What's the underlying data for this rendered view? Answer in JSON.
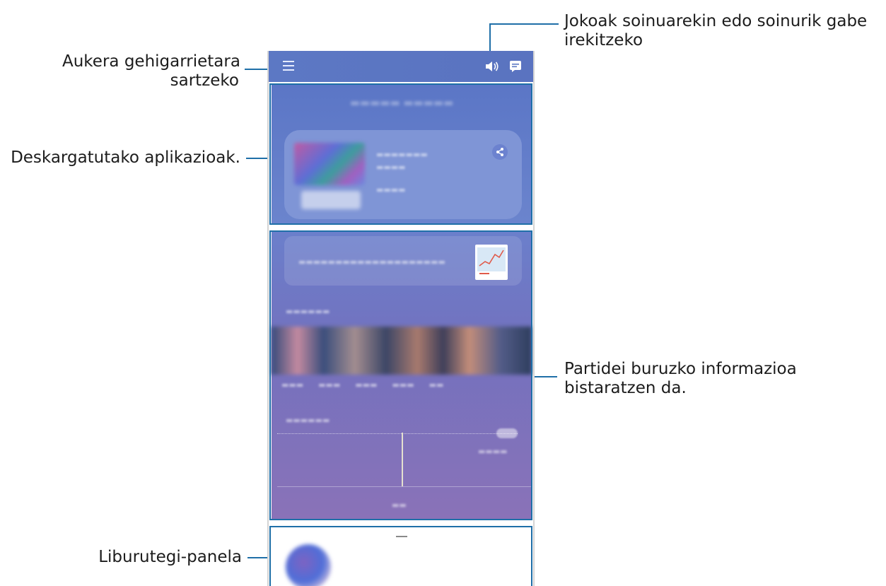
{
  "callouts": {
    "sound": [
      "Jokoak soinuarekin edo soinurik gabe",
      "irekitzeko"
    ],
    "menu": [
      "Aukera gehigarrietara",
      "sartzeko"
    ],
    "downloaded": "Deskargatutako aplikazioak.",
    "game_info": [
      "Partidei buruzko informazioa",
      "bistaratzen da."
    ],
    "library": "Liburutegi-panela"
  },
  "icons": {
    "menu": "menu-icon",
    "sound": "speaker-icon",
    "chat": "chat-icon",
    "share": "share-icon"
  },
  "colors": {
    "appbar": "#5c78c4",
    "highlight": "#1f6fa8",
    "card": "#7f95d6"
  }
}
